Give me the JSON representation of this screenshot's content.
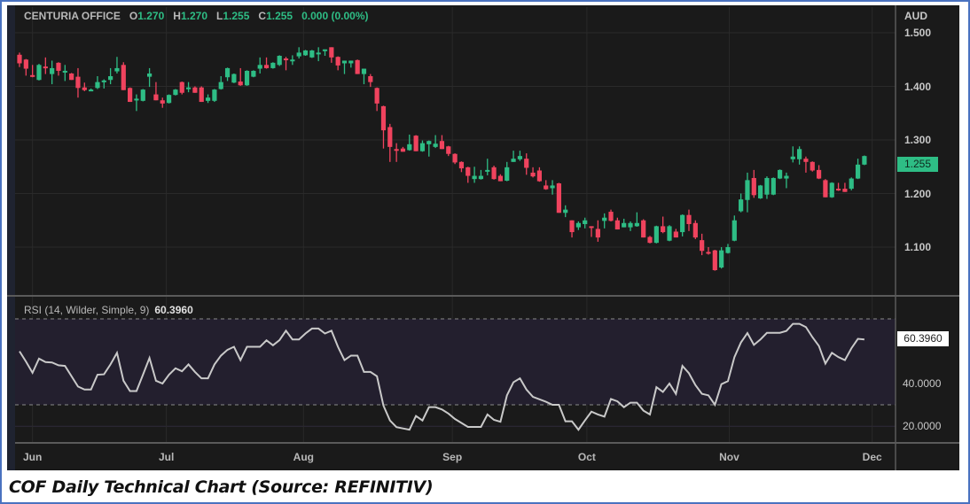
{
  "header": {
    "symbol": "CENTURIA OFFICE",
    "o_label": "O",
    "o": "1.270",
    "h_label": "H",
    "h": "1.270",
    "l_label": "L",
    "l": "1.255",
    "c_label": "C",
    "c": "1.255",
    "change": "0.000 (0.00%)"
  },
  "price_axis": {
    "currency": "AUD",
    "ticks": [
      "1.500",
      "1.400",
      "1.300",
      "1.200",
      "1.100"
    ],
    "current": "1.255"
  },
  "rsi_panel": {
    "label": "RSI (14, Wilder, Simple, 9)",
    "value": "60.3960",
    "ticks": [
      "40.0000",
      "20.0000"
    ],
    "current": "60.3960",
    "upper_band": 70,
    "lower_band": 30
  },
  "caption": "COF Daily Technical Chart (Source: REFINITIV)",
  "colors": {
    "up": "#2ebd85",
    "down": "#f0435e",
    "rsi_line": "#c9c9c9",
    "band_fill": "#231f2e"
  },
  "chart_data": {
    "type": "candlestick",
    "title": "CENTURIA OFFICE",
    "ylabel": "AUD",
    "ylim": [
      1.03,
      1.52
    ],
    "months": [
      {
        "label": "Jun",
        "index": 2
      },
      {
        "label": "Jul",
        "index": 22.6
      },
      {
        "label": "Aug",
        "index": 43.7
      },
      {
        "label": "Sep",
        "index": 66.6
      },
      {
        "label": "Oct",
        "index": 87.3
      },
      {
        "label": "Nov",
        "index": 109.2
      },
      {
        "label": "Dec",
        "index": 131.2
      }
    ],
    "candles_ohlc": [
      [
        1.459,
        1.463,
        1.436,
        1.443
      ],
      [
        1.45,
        1.451,
        1.42,
        1.433
      ],
      [
        1.421,
        1.44,
        1.417,
        1.419
      ],
      [
        1.412,
        1.442,
        1.411,
        1.44
      ],
      [
        1.437,
        1.454,
        1.423,
        1.434
      ],
      [
        1.423,
        1.448,
        1.404,
        1.434
      ],
      [
        1.444,
        1.445,
        1.42,
        1.429
      ],
      [
        1.428,
        1.44,
        1.41,
        1.429
      ],
      [
        1.424,
        1.425,
        1.412,
        1.412
      ],
      [
        1.418,
        1.434,
        1.379,
        1.397
      ],
      [
        1.398,
        1.407,
        1.391,
        1.393
      ],
      [
        1.393,
        1.396,
        1.391,
        1.394
      ],
      [
        1.397,
        1.419,
        1.395,
        1.408
      ],
      [
        1.41,
        1.413,
        1.396,
        1.411
      ],
      [
        1.412,
        1.434,
        1.404,
        1.419
      ],
      [
        1.428,
        1.455,
        1.424,
        1.434
      ],
      [
        1.44,
        1.445,
        1.393,
        1.393
      ],
      [
        1.397,
        1.398,
        1.371,
        1.371
      ],
      [
        1.376,
        1.385,
        1.354,
        1.377
      ],
      [
        1.373,
        1.395,
        1.372,
        1.394
      ],
      [
        1.418,
        1.434,
        1.399,
        1.424
      ],
      [
        1.385,
        1.408,
        1.374,
        1.374
      ],
      [
        1.374,
        1.379,
        1.36,
        1.368
      ],
      [
        1.369,
        1.385,
        1.368,
        1.384
      ],
      [
        1.384,
        1.395,
        1.383,
        1.394
      ],
      [
        1.408,
        1.409,
        1.385,
        1.388
      ],
      [
        1.397,
        1.408,
        1.389,
        1.398
      ],
      [
        1.398,
        1.4,
        1.388,
        1.388
      ],
      [
        1.398,
        1.4,
        1.371,
        1.371
      ],
      [
        1.373,
        1.385,
        1.369,
        1.379
      ],
      [
        1.373,
        1.395,
        1.371,
        1.394
      ],
      [
        1.395,
        1.419,
        1.394,
        1.408
      ],
      [
        1.417,
        1.435,
        1.41,
        1.434
      ],
      [
        1.407,
        1.424,
        1.406,
        1.423
      ],
      [
        1.409,
        1.434,
        1.401,
        1.402
      ],
      [
        1.402,
        1.43,
        1.401,
        1.429
      ],
      [
        1.418,
        1.43,
        1.417,
        1.429
      ],
      [
        1.433,
        1.454,
        1.424,
        1.44
      ],
      [
        1.44,
        1.454,
        1.433,
        1.434
      ],
      [
        1.434,
        1.445,
        1.433,
        1.444
      ],
      [
        1.44,
        1.458,
        1.438,
        1.457
      ],
      [
        1.452,
        1.455,
        1.43,
        1.45
      ],
      [
        1.449,
        1.458,
        1.44,
        1.45
      ],
      [
        1.456,
        1.473,
        1.452,
        1.463
      ],
      [
        1.458,
        1.468,
        1.457,
        1.467
      ],
      [
        1.454,
        1.468,
        1.453,
        1.467
      ],
      [
        1.463,
        1.473,
        1.447,
        1.463
      ],
      [
        1.468,
        1.469,
        1.457,
        1.469
      ],
      [
        1.473,
        1.473,
        1.444,
        1.454
      ],
      [
        1.455,
        1.456,
        1.43,
        1.439
      ],
      [
        1.443,
        1.448,
        1.423,
        1.448
      ],
      [
        1.443,
        1.448,
        1.435,
        1.448
      ],
      [
        1.449,
        1.45,
        1.423,
        1.423
      ],
      [
        1.423,
        1.433,
        1.404,
        1.433
      ],
      [
        1.419,
        1.423,
        1.399,
        1.408
      ],
      [
        1.397,
        1.398,
        1.354,
        1.368
      ],
      [
        1.363,
        1.364,
        1.284,
        1.318
      ],
      [
        1.324,
        1.33,
        1.259,
        1.287
      ],
      [
        1.283,
        1.294,
        1.259,
        1.282
      ],
      [
        1.284,
        1.287,
        1.278,
        1.278
      ],
      [
        1.281,
        1.31,
        1.28,
        1.292
      ],
      [
        1.308,
        1.309,
        1.279,
        1.279
      ],
      [
        1.279,
        1.299,
        1.278,
        1.294
      ],
      [
        1.292,
        1.299,
        1.269,
        1.298
      ],
      [
        1.287,
        1.309,
        1.285,
        1.293
      ],
      [
        1.298,
        1.309,
        1.283,
        1.283
      ],
      [
        1.288,
        1.289,
        1.27,
        1.274
      ],
      [
        1.274,
        1.275,
        1.255,
        1.258
      ],
      [
        1.259,
        1.26,
        1.24,
        1.247
      ],
      [
        1.249,
        1.25,
        1.22,
        1.233
      ],
      [
        1.227,
        1.25,
        1.22,
        1.233
      ],
      [
        1.227,
        1.244,
        1.226,
        1.233
      ],
      [
        1.243,
        1.265,
        1.234,
        1.244
      ],
      [
        1.249,
        1.252,
        1.226,
        1.227
      ],
      [
        1.233,
        1.236,
        1.223,
        1.223
      ],
      [
        1.224,
        1.259,
        1.223,
        1.249
      ],
      [
        1.259,
        1.28,
        1.259,
        1.265
      ],
      [
        1.264,
        1.28,
        1.261,
        1.27
      ],
      [
        1.265,
        1.275,
        1.235,
        1.248
      ],
      [
        1.239,
        1.249,
        1.23,
        1.232
      ],
      [
        1.243,
        1.249,
        1.222,
        1.223
      ],
      [
        1.215,
        1.225,
        1.207,
        1.208
      ],
      [
        1.21,
        1.225,
        1.198,
        1.215
      ],
      [
        1.219,
        1.22,
        1.164,
        1.164
      ],
      [
        1.164,
        1.178,
        1.156,
        1.17
      ],
      [
        1.15,
        1.15,
        1.118,
        1.128
      ],
      [
        1.137,
        1.148,
        1.132,
        1.145
      ],
      [
        1.143,
        1.155,
        1.135,
        1.15
      ],
      [
        1.139,
        1.139,
        1.119,
        1.138
      ],
      [
        1.134,
        1.15,
        1.11,
        1.118
      ],
      [
        1.149,
        1.163,
        1.135,
        1.155
      ],
      [
        1.166,
        1.17,
        1.148,
        1.149
      ],
      [
        1.15,
        1.155,
        1.133,
        1.133
      ],
      [
        1.137,
        1.153,
        1.137,
        1.145
      ],
      [
        1.137,
        1.148,
        1.13,
        1.145
      ],
      [
        1.139,
        1.165,
        1.138,
        1.145
      ],
      [
        1.15,
        1.152,
        1.118,
        1.118
      ],
      [
        1.119,
        1.121,
        1.107,
        1.108
      ],
      [
        1.108,
        1.14,
        1.107,
        1.139
      ],
      [
        1.139,
        1.157,
        1.126,
        1.128
      ],
      [
        1.112,
        1.141,
        1.111,
        1.139
      ],
      [
        1.129,
        1.134,
        1.118,
        1.118
      ],
      [
        1.128,
        1.161,
        1.12,
        1.16
      ],
      [
        1.16,
        1.17,
        1.13,
        1.143
      ],
      [
        1.145,
        1.15,
        1.115,
        1.118
      ],
      [
        1.113,
        1.125,
        1.085,
        1.093
      ],
      [
        1.091,
        1.1,
        1.086,
        1.09
      ],
      [
        1.094,
        1.095,
        1.056,
        1.057
      ],
      [
        1.062,
        1.1,
        1.06,
        1.094
      ],
      [
        1.089,
        1.106,
        1.088,
        1.1
      ],
      [
        1.112,
        1.159,
        1.111,
        1.15
      ],
      [
        1.167,
        1.2,
        1.165,
        1.189
      ],
      [
        1.188,
        1.239,
        1.165,
        1.225
      ],
      [
        1.229,
        1.244,
        1.192,
        1.197
      ],
      [
        1.191,
        1.216,
        1.19,
        1.215
      ],
      [
        1.198,
        1.232,
        1.19,
        1.229
      ],
      [
        1.198,
        1.23,
        1.197,
        1.229
      ],
      [
        1.228,
        1.245,
        1.227,
        1.244
      ],
      [
        1.228,
        1.239,
        1.21,
        1.233
      ],
      [
        1.264,
        1.288,
        1.258,
        1.269
      ],
      [
        1.264,
        1.288,
        1.254,
        1.283
      ],
      [
        1.265,
        1.269,
        1.239,
        1.259
      ],
      [
        1.259,
        1.26,
        1.241,
        1.243
      ],
      [
        1.244,
        1.253,
        1.227,
        1.228
      ],
      [
        1.225,
        1.227,
        1.193,
        1.193
      ],
      [
        1.193,
        1.221,
        1.192,
        1.22
      ],
      [
        1.209,
        1.22,
        1.205,
        1.208
      ],
      [
        1.209,
        1.22,
        1.203,
        1.203
      ],
      [
        1.209,
        1.23,
        1.206,
        1.228
      ],
      [
        1.228,
        1.265,
        1.227,
        1.254
      ],
      [
        1.254,
        1.271,
        1.253,
        1.27
      ]
    ],
    "rsi_points": [
      [
        0,
        54.9
      ],
      [
        1,
        50.1
      ],
      [
        2,
        44.9
      ],
      [
        3,
        51.5
      ],
      [
        4,
        49.9
      ],
      [
        5,
        49.7
      ],
      [
        6,
        48.4
      ],
      [
        7,
        48.1
      ],
      [
        9,
        38.5
      ],
      [
        10,
        37.1
      ],
      [
        11,
        37.1
      ],
      [
        12,
        44.0
      ],
      [
        13,
        44.2
      ],
      [
        14,
        48.8
      ],
      [
        15,
        54.2
      ],
      [
        16,
        41.2
      ],
      [
        17,
        36.4
      ],
      [
        18,
        36.4
      ],
      [
        19,
        44.0
      ],
      [
        20,
        51.8
      ],
      [
        21,
        41.2
      ],
      [
        22,
        39.9
      ],
      [
        23,
        44.0
      ],
      [
        24,
        47.0
      ],
      [
        25,
        45.6
      ],
      [
        26,
        48.8
      ],
      [
        27,
        45.3
      ],
      [
        28,
        42.3
      ],
      [
        29,
        42.3
      ],
      [
        30,
        48.8
      ],
      [
        31,
        52.9
      ],
      [
        32,
        55.6
      ],
      [
        33,
        57.0
      ],
      [
        34,
        50.8
      ],
      [
        35,
        57.0
      ],
      [
        37,
        57.0
      ],
      [
        38,
        60.0
      ],
      [
        39,
        57.7
      ],
      [
        40,
        60.1
      ],
      [
        41,
        64.5
      ],
      [
        42,
        60.4
      ],
      [
        43,
        60.4
      ],
      [
        44,
        63.2
      ],
      [
        45,
        65.5
      ],
      [
        46,
        65.5
      ],
      [
        47,
        63.2
      ],
      [
        48,
        64.5
      ],
      [
        49,
        57.0
      ],
      [
        50,
        50.8
      ],
      [
        51,
        52.9
      ],
      [
        52,
        52.9
      ],
      [
        53,
        45.3
      ],
      [
        54,
        45.3
      ],
      [
        55,
        43.3
      ],
      [
        56,
        29.6
      ],
      [
        57,
        22.7
      ],
      [
        58,
        19.6
      ],
      [
        59,
        19.0
      ],
      [
        60,
        18.4
      ],
      [
        61,
        24.8
      ],
      [
        62,
        22.7
      ],
      [
        63,
        28.9
      ],
      [
        64,
        28.9
      ],
      [
        65,
        27.8
      ],
      [
        66,
        25.9
      ],
      [
        67,
        23.4
      ],
      [
        69,
        19.7
      ],
      [
        71,
        19.7
      ],
      [
        72,
        25.5
      ],
      [
        73,
        23.0
      ],
      [
        74,
        22.1
      ],
      [
        75,
        34.4
      ],
      [
        76,
        40.5
      ],
      [
        77,
        42.3
      ],
      [
        78,
        37.1
      ],
      [
        79,
        33.7
      ],
      [
        81,
        31.4
      ],
      [
        82,
        30.0
      ],
      [
        83,
        30.0
      ],
      [
        84,
        22.3
      ],
      [
        85,
        22.3
      ],
      [
        86,
        18.4
      ],
      [
        87,
        22.7
      ],
      [
        88,
        26.8
      ],
      [
        89,
        25.5
      ],
      [
        90,
        24.5
      ],
      [
        91,
        32.7
      ],
      [
        92,
        31.6
      ],
      [
        93,
        28.9
      ],
      [
        94,
        31.0
      ],
      [
        95,
        31.0
      ],
      [
        96,
        27.3
      ],
      [
        97,
        25.5
      ],
      [
        98,
        38.2
      ],
      [
        99,
        36.0
      ],
      [
        100,
        39.9
      ],
      [
        101,
        35.1
      ],
      [
        102,
        48.1
      ],
      [
        103,
        44.7
      ],
      [
        104,
        39.2
      ],
      [
        105,
        35.1
      ],
      [
        106,
        34.4
      ],
      [
        107,
        30.0
      ],
      [
        108,
        39.6
      ],
      [
        109,
        41.0
      ],
      [
        110,
        52.2
      ],
      [
        111,
        59.0
      ],
      [
        112,
        63.4
      ],
      [
        113,
        57.9
      ],
      [
        114,
        60.4
      ],
      [
        115,
        63.5
      ],
      [
        117,
        63.5
      ],
      [
        118,
        64.4
      ],
      [
        119,
        67.7
      ],
      [
        120,
        67.7
      ],
      [
        121,
        66.2
      ],
      [
        122,
        61.5
      ],
      [
        123,
        57.4
      ],
      [
        124,
        49.2
      ],
      [
        125,
        54.2
      ],
      [
        126,
        52.2
      ],
      [
        127,
        50.8
      ],
      [
        128,
        56.3
      ],
      [
        129,
        60.7
      ],
      [
        130,
        60.4
      ]
    ]
  }
}
